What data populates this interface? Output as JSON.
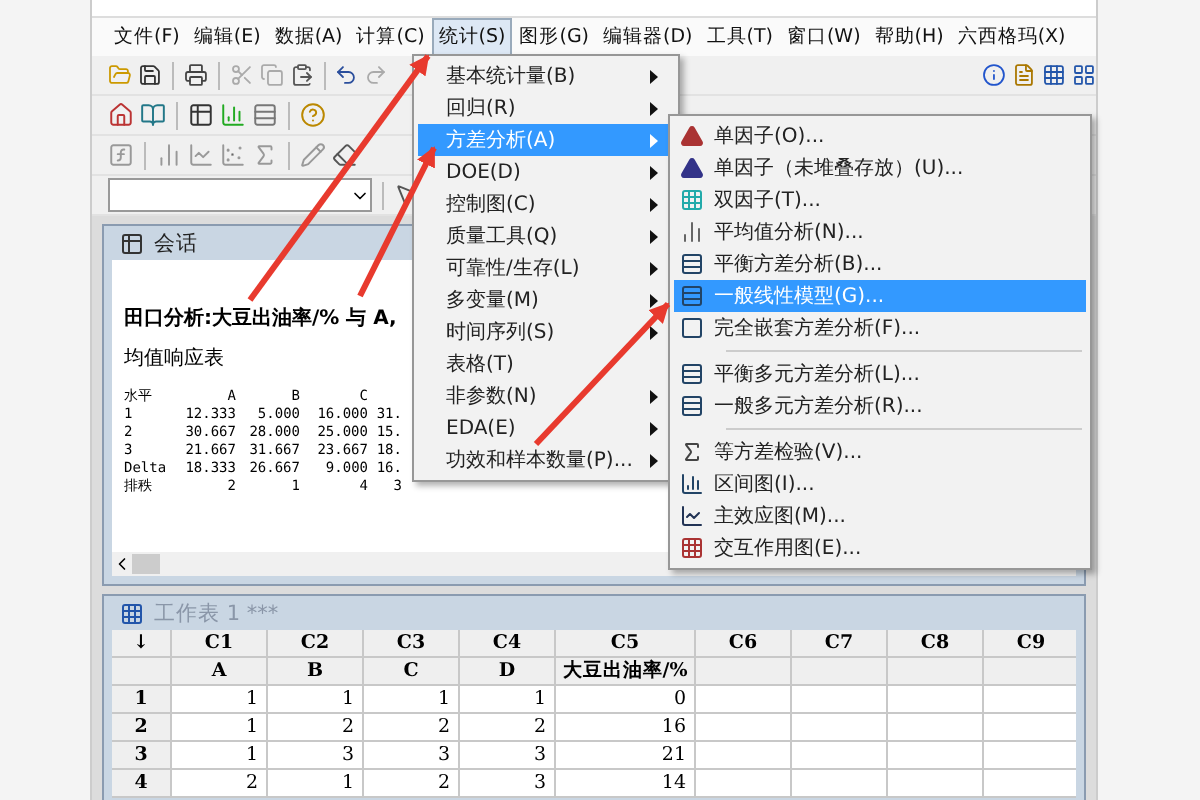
{
  "menubar": [
    {
      "label": "文件(F)",
      "selected": false
    },
    {
      "label": "编辑(E)",
      "selected": false
    },
    {
      "label": "数据(A)",
      "selected": false
    },
    {
      "label": "计算(C)",
      "selected": false
    },
    {
      "label": "统计(S)",
      "selected": true
    },
    {
      "label": "图形(G)",
      "selected": false
    },
    {
      "label": "编辑器(D)",
      "selected": false
    },
    {
      "label": "工具(T)",
      "selected": false
    },
    {
      "label": "窗口(W)",
      "selected": false
    },
    {
      "label": "帮助(H)",
      "selected": false
    },
    {
      "label": "六西格玛(X)",
      "selected": false
    }
  ],
  "stats_menu": {
    "items": [
      {
        "label": "基本统计量(B)",
        "submenu": true,
        "selected": false
      },
      {
        "label": "回归(R)",
        "submenu": true,
        "selected": false
      },
      {
        "label": "方差分析(A)",
        "submenu": true,
        "selected": true
      },
      {
        "label": "DOE(D)",
        "submenu": true,
        "selected": false
      },
      {
        "label": "控制图(C)",
        "submenu": true,
        "selected": false
      },
      {
        "label": "质量工具(Q)",
        "submenu": true,
        "selected": false
      },
      {
        "label": "可靠性/生存(L)",
        "submenu": true,
        "selected": false
      },
      {
        "label": "多变量(M)",
        "submenu": true,
        "selected": false
      },
      {
        "label": "时间序列(S)",
        "submenu": true,
        "selected": false
      },
      {
        "label": "表格(T)",
        "submenu": false,
        "selected": false
      },
      {
        "label": "非参数(N)",
        "submenu": true,
        "selected": false
      },
      {
        "label": "EDA(E)",
        "submenu": true,
        "selected": false
      },
      {
        "label": "功效和样本数量(P)...",
        "submenu": true,
        "selected": false
      }
    ]
  },
  "anova_submenu": {
    "groups": [
      {
        "items": [
          {
            "label": "单因子(O)...",
            "selected": false
          },
          {
            "label": "单因子（未堆叠存放）(U)...",
            "selected": false
          },
          {
            "label": "双因子(T)...",
            "selected": false
          },
          {
            "label": "平均值分析(N)...",
            "selected": false
          },
          {
            "label": "平衡方差分析(B)...",
            "selected": false
          },
          {
            "label": "一般线性模型(G)...",
            "selected": true
          },
          {
            "label": "完全嵌套方差分析(F)...",
            "selected": false
          }
        ]
      },
      {
        "items": [
          {
            "label": "平衡多元方差分析(L)...",
            "selected": false
          },
          {
            "label": "一般多元方差分析(R)...",
            "selected": false
          }
        ]
      },
      {
        "items": [
          {
            "label": "等方差检验(V)...",
            "selected": false
          },
          {
            "label": "区间图(I)...",
            "selected": false
          },
          {
            "label": "主效应图(M)...",
            "selected": false
          },
          {
            "label": "交互作用图(E)...",
            "selected": false
          }
        ]
      }
    ]
  },
  "session": {
    "title": "会话",
    "heading": "田口分析:大豆出油率/% 与 A,",
    "subheading": "均值响应表",
    "columns": [
      "水平",
      "A",
      "B",
      "C"
    ],
    "rows": [
      {
        "label": "1",
        "values": [
          "12.333",
          "5.000",
          "16.000",
          "31."
        ]
      },
      {
        "label": "2",
        "values": [
          "30.667",
          "28.000",
          "25.000",
          "15."
        ]
      },
      {
        "label": "3",
        "values": [
          "21.667",
          "31.667",
          "23.667",
          "18."
        ]
      },
      {
        "label": "Delta",
        "values": [
          "18.333",
          "26.667",
          "9.000",
          "16."
        ]
      },
      {
        "label": "排秩",
        "values": [
          "2",
          "1",
          "4",
          "3"
        ]
      }
    ]
  },
  "worksheet": {
    "title": "工作表 1 ***",
    "corner": "↓",
    "columns": [
      {
        "id": "C1",
        "name": "A"
      },
      {
        "id": "C2",
        "name": "B"
      },
      {
        "id": "C3",
        "name": "C"
      },
      {
        "id": "C4",
        "name": "D"
      },
      {
        "id": "C5",
        "name": "大豆出油率/%"
      },
      {
        "id": "C6"
      },
      {
        "id": "C7"
      },
      {
        "id": "C8"
      },
      {
        "id": "C9"
      }
    ],
    "rows": [
      {
        "number": "1",
        "cells": [
          "1",
          "1",
          "1",
          "1",
          "0"
        ]
      },
      {
        "number": "2",
        "cells": [
          "1",
          "2",
          "2",
          "2",
          "16"
        ]
      },
      {
        "number": "3",
        "cells": [
          "1",
          "3",
          "3",
          "3",
          "21"
        ]
      },
      {
        "number": "4",
        "cells": [
          "2",
          "1",
          "2",
          "3",
          "14"
        ]
      }
    ]
  }
}
